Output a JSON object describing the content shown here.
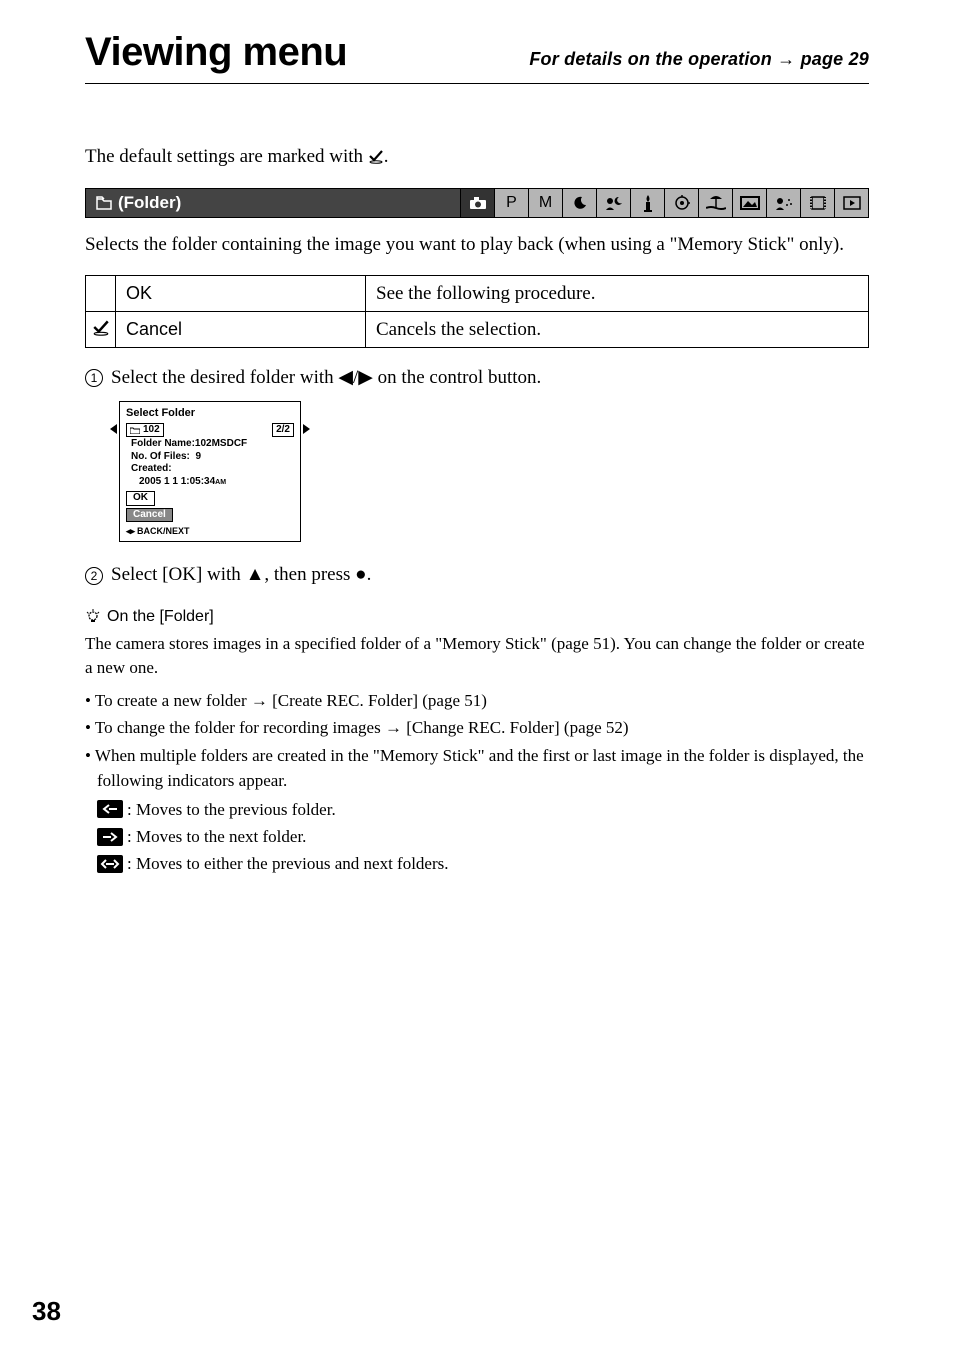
{
  "header": {
    "title": "Viewing menu",
    "subtitle_prefix": "For details on the operation",
    "subtitle_arrow": "→",
    "subtitle_page": "page 29"
  },
  "intro": {
    "text_before": "The default settings are marked with ",
    "text_after": "."
  },
  "section": {
    "label": " (Folder)",
    "modes": [
      "camera",
      "P",
      "M",
      "moon",
      "portrait",
      "candle",
      "timer",
      "beach",
      "landscape",
      "snow",
      "movie",
      "play"
    ]
  },
  "desc": "Selects the folder containing the image you want to play back (when using a \"Memory Stick\" only).",
  "options": [
    {
      "mark": false,
      "label": "OK",
      "desc": "See the following procedure."
    },
    {
      "mark": true,
      "label": "Cancel",
      "desc": "Cancels the selection."
    }
  ],
  "step1": {
    "num": "1",
    "before": "Select the desired folder with ",
    "after": " on the control button."
  },
  "lcd": {
    "title": "Select Folder",
    "folder_num": "102",
    "count": "2/2",
    "folder_name_label": "Folder Name:",
    "folder_name": "102MSDCF",
    "files_label": "No. Of Files:",
    "files": "9",
    "created_label": "Created:",
    "created": "2005   1   1   1:05:34",
    "created_ampm": "AM",
    "ok": "OK",
    "cancel": "Cancel",
    "footer": "BACK/NEXT"
  },
  "step2": {
    "num": "2",
    "before": "Select [OK] with ",
    "mid": ", then press ",
    "after": "."
  },
  "hint": {
    "heading": "On the [Folder]",
    "body": "The camera stores images in a specified folder of a \"Memory Stick\" (page 51). You can change the folder or create a new one.",
    "b1_before": "To create a new folder ",
    "b1_after": " [Create REC. Folder] (page 51)",
    "b2_before": "To change the folder for recording images ",
    "b2_after": " [Change REC. Folder] (page 52)",
    "b3": "When multiple folders are created in the \"Memory Stick\" and the first or last image in the folder is displayed, the following indicators appear.",
    "ind1": ": Moves to the previous folder.",
    "ind2": ": Moves to the next folder.",
    "ind3": ": Moves to either the previous and next folders."
  },
  "page_number": "38"
}
